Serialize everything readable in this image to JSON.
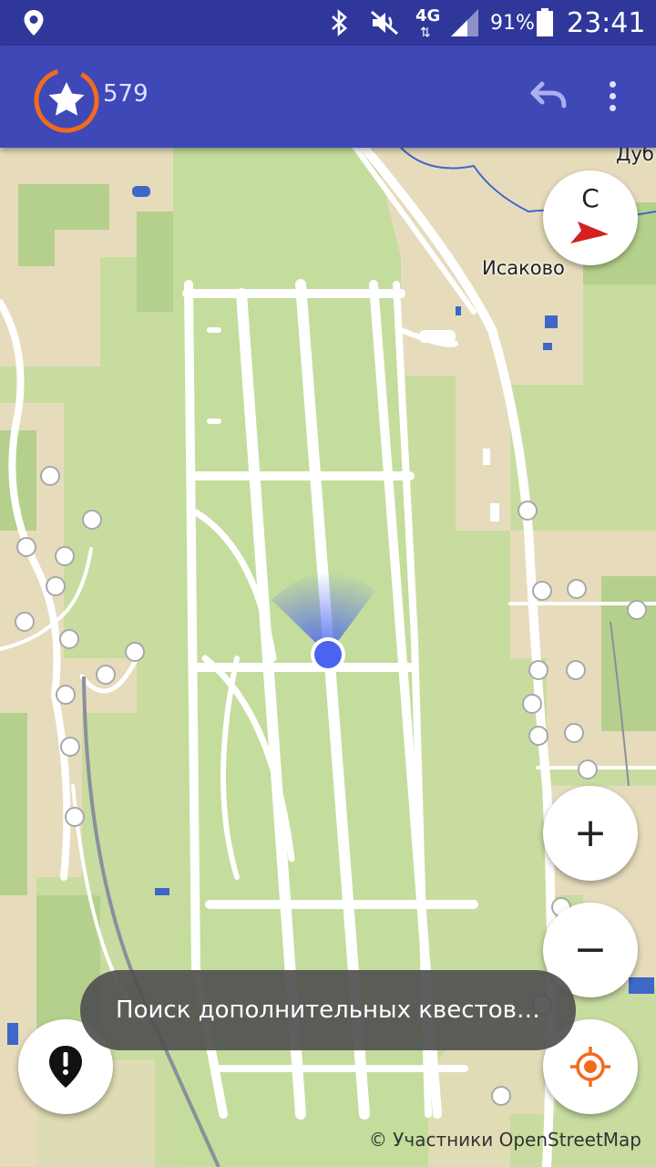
{
  "status_bar": {
    "battery_percent": "91%",
    "time": "23:41",
    "network_type": "4G",
    "icons": [
      "location-icon",
      "bluetooth-icon",
      "mute-icon",
      "signal-icon",
      "battery-icon"
    ]
  },
  "app_bar": {
    "points": "579",
    "icons": [
      "star-badge-icon",
      "undo-icon",
      "overflow-menu-icon"
    ]
  },
  "map": {
    "place_labels": {
      "isakovo": "Исаково",
      "edge_label": "Дуб"
    },
    "attribution": "© Участники OpenStreetMap"
  },
  "controls": {
    "compass_letter": "С",
    "zoom_in": "+",
    "zoom_out": "−"
  },
  "toast": {
    "message": "Поиск дополнительных квестов…"
  },
  "colors": {
    "status_bar": "#30379b",
    "app_bar": "#3f48b7",
    "accent": "#f26b1d",
    "location_dot": "#4a64f0",
    "map_green": "#c8dca0",
    "map_urban": "#e8dcbc",
    "runway": "#ffffff"
  }
}
